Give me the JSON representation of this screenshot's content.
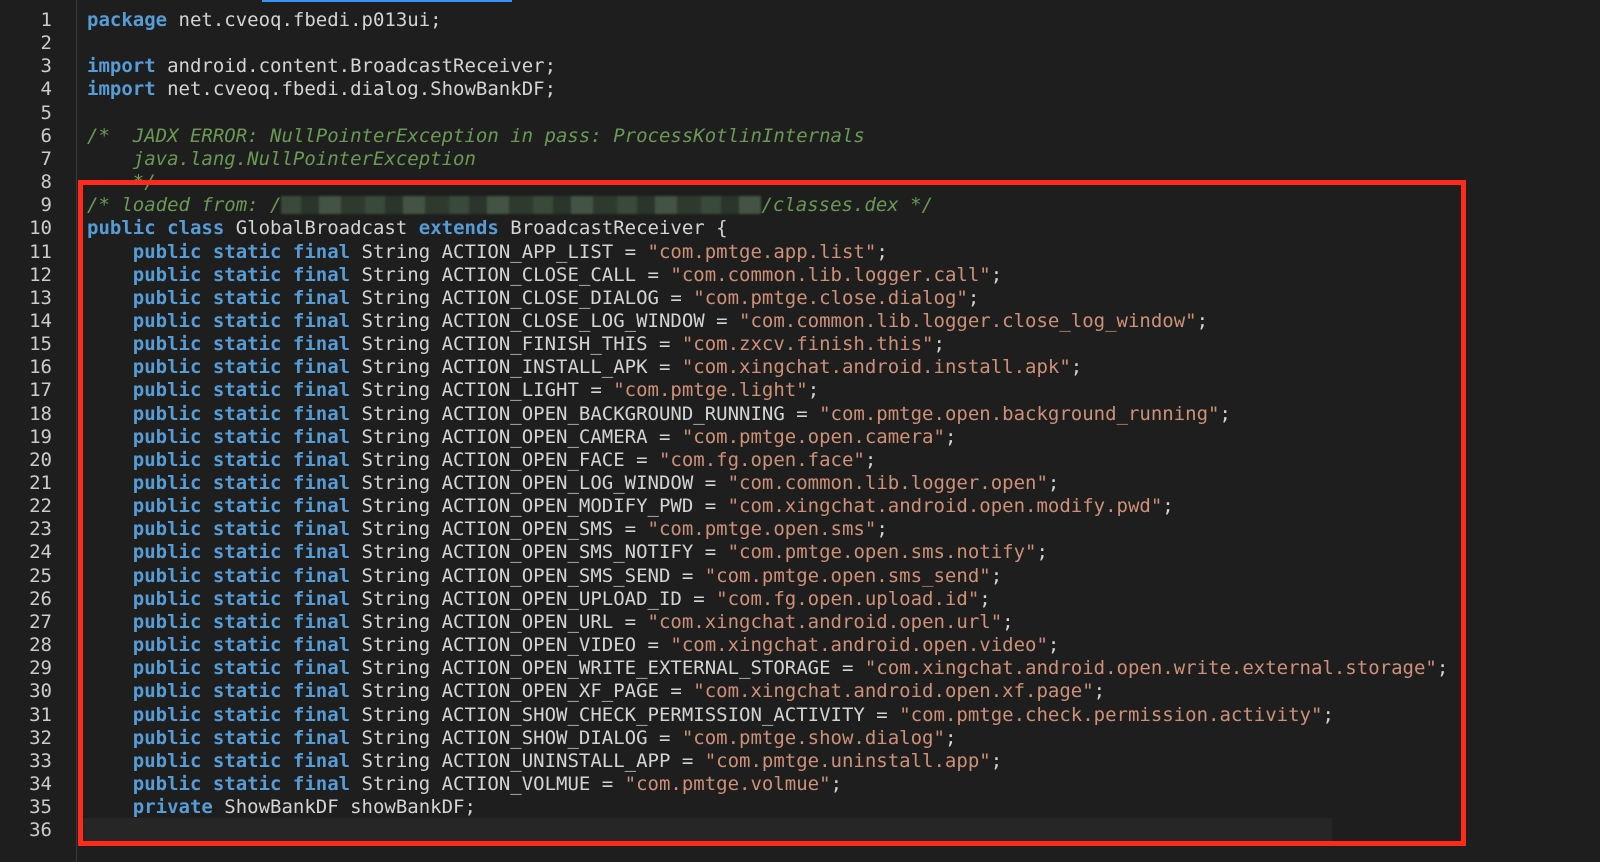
{
  "editor": {
    "lines": [
      {
        "n": "1",
        "tokens": [
          {
            "t": "kw",
            "v": "package"
          },
          {
            "t": "ty",
            "v": " net.cveoq.fbedi.p013ui;"
          }
        ]
      },
      {
        "n": "2",
        "tokens": []
      },
      {
        "n": "3",
        "tokens": [
          {
            "t": "kw",
            "v": "import"
          },
          {
            "t": "ty",
            "v": " android.content.BroadcastReceiver;"
          }
        ]
      },
      {
        "n": "4",
        "tokens": [
          {
            "t": "kw",
            "v": "import"
          },
          {
            "t": "ty",
            "v": " net.cveoq.fbedi.dialog.ShowBankDF;"
          }
        ]
      },
      {
        "n": "5",
        "tokens": []
      },
      {
        "n": "6",
        "tokens": [
          {
            "t": "cm",
            "v": "/*  JADX ERROR: NullPointerException in pass: ProcessKotlinInternals"
          }
        ]
      },
      {
        "n": "7",
        "tokens": [
          {
            "t": "cm",
            "v": "    java.lang.NullPointerException"
          }
        ]
      },
      {
        "n": "8",
        "tokens": [
          {
            "t": "cm",
            "v": "    */"
          }
        ]
      },
      {
        "n": "9",
        "tokens": [
          {
            "t": "cm",
            "v": "/* loaded from: /"
          },
          {
            "t": "redact",
            "v": ""
          },
          {
            "t": "cm",
            "v": "/classes.dex */"
          }
        ]
      },
      {
        "n": "10",
        "tokens": [
          {
            "t": "kw",
            "v": "public class"
          },
          {
            "t": "ty",
            "v": " GlobalBroadcast "
          },
          {
            "t": "kw",
            "v": "extends"
          },
          {
            "t": "ty",
            "v": " BroadcastReceiver {"
          }
        ]
      },
      {
        "n": "11",
        "tokens": [
          {
            "t": "ty",
            "v": "    "
          },
          {
            "t": "kw",
            "v": "public static final"
          },
          {
            "t": "ty",
            "v": " String ACTION_APP_LIST = "
          },
          {
            "t": "str",
            "v": "\"com.pmtge.app.list\""
          },
          {
            "t": "ty",
            "v": ";"
          }
        ]
      },
      {
        "n": "12",
        "tokens": [
          {
            "t": "ty",
            "v": "    "
          },
          {
            "t": "kw",
            "v": "public static final"
          },
          {
            "t": "ty",
            "v": " String ACTION_CLOSE_CALL = "
          },
          {
            "t": "str",
            "v": "\"com.common.lib.logger.call\""
          },
          {
            "t": "ty",
            "v": ";"
          }
        ]
      },
      {
        "n": "13",
        "tokens": [
          {
            "t": "ty",
            "v": "    "
          },
          {
            "t": "kw",
            "v": "public static final"
          },
          {
            "t": "ty",
            "v": " String ACTION_CLOSE_DIALOG = "
          },
          {
            "t": "str",
            "v": "\"com.pmtge.close.dialog\""
          },
          {
            "t": "ty",
            "v": ";"
          }
        ]
      },
      {
        "n": "14",
        "tokens": [
          {
            "t": "ty",
            "v": "    "
          },
          {
            "t": "kw",
            "v": "public static final"
          },
          {
            "t": "ty",
            "v": " String ACTION_CLOSE_LOG_WINDOW = "
          },
          {
            "t": "str",
            "v": "\"com.common.lib.logger.close_log_window\""
          },
          {
            "t": "ty",
            "v": ";"
          }
        ]
      },
      {
        "n": "15",
        "tokens": [
          {
            "t": "ty",
            "v": "    "
          },
          {
            "t": "kw",
            "v": "public static final"
          },
          {
            "t": "ty",
            "v": " String ACTION_FINISH_THIS = "
          },
          {
            "t": "str",
            "v": "\"com.zxcv.finish.this\""
          },
          {
            "t": "ty",
            "v": ";"
          }
        ]
      },
      {
        "n": "16",
        "tokens": [
          {
            "t": "ty",
            "v": "    "
          },
          {
            "t": "kw",
            "v": "public static final"
          },
          {
            "t": "ty",
            "v": " String ACTION_INSTALL_APK = "
          },
          {
            "t": "str",
            "v": "\"com.xingchat.android.install.apk\""
          },
          {
            "t": "ty",
            "v": ";"
          }
        ]
      },
      {
        "n": "17",
        "tokens": [
          {
            "t": "ty",
            "v": "    "
          },
          {
            "t": "kw",
            "v": "public static final"
          },
          {
            "t": "ty",
            "v": " String ACTION_LIGHT = "
          },
          {
            "t": "str",
            "v": "\"com.pmtge.light\""
          },
          {
            "t": "ty",
            "v": ";"
          }
        ]
      },
      {
        "n": "18",
        "tokens": [
          {
            "t": "ty",
            "v": "    "
          },
          {
            "t": "kw",
            "v": "public static final"
          },
          {
            "t": "ty",
            "v": " String ACTION_OPEN_BACKGROUND_RUNNING = "
          },
          {
            "t": "str",
            "v": "\"com.pmtge.open.background_running\""
          },
          {
            "t": "ty",
            "v": ";"
          }
        ]
      },
      {
        "n": "19",
        "tokens": [
          {
            "t": "ty",
            "v": "    "
          },
          {
            "t": "kw",
            "v": "public static final"
          },
          {
            "t": "ty",
            "v": " String ACTION_OPEN_CAMERA = "
          },
          {
            "t": "str",
            "v": "\"com.pmtge.open.camera\""
          },
          {
            "t": "ty",
            "v": ";"
          }
        ]
      },
      {
        "n": "20",
        "tokens": [
          {
            "t": "ty",
            "v": "    "
          },
          {
            "t": "kw",
            "v": "public static final"
          },
          {
            "t": "ty",
            "v": " String ACTION_OPEN_FACE = "
          },
          {
            "t": "str",
            "v": "\"com.fg.open.face\""
          },
          {
            "t": "ty",
            "v": ";"
          }
        ]
      },
      {
        "n": "21",
        "tokens": [
          {
            "t": "ty",
            "v": "    "
          },
          {
            "t": "kw",
            "v": "public static final"
          },
          {
            "t": "ty",
            "v": " String ACTION_OPEN_LOG_WINDOW = "
          },
          {
            "t": "str",
            "v": "\"com.common.lib.logger.open\""
          },
          {
            "t": "ty",
            "v": ";"
          }
        ]
      },
      {
        "n": "22",
        "tokens": [
          {
            "t": "ty",
            "v": "    "
          },
          {
            "t": "kw",
            "v": "public static final"
          },
          {
            "t": "ty",
            "v": " String ACTION_OPEN_MODIFY_PWD = "
          },
          {
            "t": "str",
            "v": "\"com.xingchat.android.open.modify.pwd\""
          },
          {
            "t": "ty",
            "v": ";"
          }
        ]
      },
      {
        "n": "23",
        "tokens": [
          {
            "t": "ty",
            "v": "    "
          },
          {
            "t": "kw",
            "v": "public static final"
          },
          {
            "t": "ty",
            "v": " String ACTION_OPEN_SMS = "
          },
          {
            "t": "str",
            "v": "\"com.pmtge.open.sms\""
          },
          {
            "t": "ty",
            "v": ";"
          }
        ]
      },
      {
        "n": "24",
        "tokens": [
          {
            "t": "ty",
            "v": "    "
          },
          {
            "t": "kw",
            "v": "public static final"
          },
          {
            "t": "ty",
            "v": " String ACTION_OPEN_SMS_NOTIFY = "
          },
          {
            "t": "str",
            "v": "\"com.pmtge.open.sms.notify\""
          },
          {
            "t": "ty",
            "v": ";"
          }
        ]
      },
      {
        "n": "25",
        "tokens": [
          {
            "t": "ty",
            "v": "    "
          },
          {
            "t": "kw",
            "v": "public static final"
          },
          {
            "t": "ty",
            "v": " String ACTION_OPEN_SMS_SEND = "
          },
          {
            "t": "str",
            "v": "\"com.pmtge.open.sms_send\""
          },
          {
            "t": "ty",
            "v": ";"
          }
        ]
      },
      {
        "n": "26",
        "tokens": [
          {
            "t": "ty",
            "v": "    "
          },
          {
            "t": "kw",
            "v": "public static final"
          },
          {
            "t": "ty",
            "v": " String ACTION_OPEN_UPLOAD_ID = "
          },
          {
            "t": "str",
            "v": "\"com.fg.open.upload.id\""
          },
          {
            "t": "ty",
            "v": ";"
          }
        ]
      },
      {
        "n": "27",
        "tokens": [
          {
            "t": "ty",
            "v": "    "
          },
          {
            "t": "kw",
            "v": "public static final"
          },
          {
            "t": "ty",
            "v": " String ACTION_OPEN_URL = "
          },
          {
            "t": "str",
            "v": "\"com.xingchat.android.open.url\""
          },
          {
            "t": "ty",
            "v": ";"
          }
        ]
      },
      {
        "n": "28",
        "tokens": [
          {
            "t": "ty",
            "v": "    "
          },
          {
            "t": "kw",
            "v": "public static final"
          },
          {
            "t": "ty",
            "v": " String ACTION_OPEN_VIDEO = "
          },
          {
            "t": "str",
            "v": "\"com.xingchat.android.open.video\""
          },
          {
            "t": "ty",
            "v": ";"
          }
        ]
      },
      {
        "n": "29",
        "tokens": [
          {
            "t": "ty",
            "v": "    "
          },
          {
            "t": "kw",
            "v": "public static final"
          },
          {
            "t": "ty",
            "v": " String ACTION_OPEN_WRITE_EXTERNAL_STORAGE = "
          },
          {
            "t": "str",
            "v": "\"com.xingchat.android.open.write.external.storage\""
          },
          {
            "t": "ty",
            "v": ";"
          }
        ]
      },
      {
        "n": "30",
        "tokens": [
          {
            "t": "ty",
            "v": "    "
          },
          {
            "t": "kw",
            "v": "public static final"
          },
          {
            "t": "ty",
            "v": " String ACTION_OPEN_XF_PAGE = "
          },
          {
            "t": "str",
            "v": "\"com.xingchat.android.open.xf.page\""
          },
          {
            "t": "ty",
            "v": ";"
          }
        ]
      },
      {
        "n": "31",
        "tokens": [
          {
            "t": "ty",
            "v": "    "
          },
          {
            "t": "kw",
            "v": "public static final"
          },
          {
            "t": "ty",
            "v": " String ACTION_SHOW_CHECK_PERMISSION_ACTIVITY = "
          },
          {
            "t": "str",
            "v": "\"com.pmtge.check.permission.activity\""
          },
          {
            "t": "ty",
            "v": ";"
          }
        ]
      },
      {
        "n": "32",
        "tokens": [
          {
            "t": "ty",
            "v": "    "
          },
          {
            "t": "kw",
            "v": "public static final"
          },
          {
            "t": "ty",
            "v": " String ACTION_SHOW_DIALOG = "
          },
          {
            "t": "str",
            "v": "\"com.pmtge.show.dialog\""
          },
          {
            "t": "ty",
            "v": ";"
          }
        ]
      },
      {
        "n": "33",
        "tokens": [
          {
            "t": "ty",
            "v": "    "
          },
          {
            "t": "kw",
            "v": "public static final"
          },
          {
            "t": "ty",
            "v": " String ACTION_UNINSTALL_APP = "
          },
          {
            "t": "str",
            "v": "\"com.pmtge.uninstall.app\""
          },
          {
            "t": "ty",
            "v": ";"
          }
        ]
      },
      {
        "n": "34",
        "tokens": [
          {
            "t": "ty",
            "v": "    "
          },
          {
            "t": "kw",
            "v": "public static final"
          },
          {
            "t": "ty",
            "v": " String ACTION_VOLMUE = "
          },
          {
            "t": "str",
            "v": "\"com.pmtge.volmue\""
          },
          {
            "t": "ty",
            "v": ";"
          }
        ]
      },
      {
        "n": "35",
        "tokens": [
          {
            "t": "ty",
            "v": "    "
          },
          {
            "t": "kw",
            "v": "private"
          },
          {
            "t": "ty",
            "v": " ShowBankDF showBankDF;"
          }
        ]
      },
      {
        "n": "36",
        "tokens": []
      }
    ]
  },
  "colors": {
    "background": "#1e1e1e",
    "keyword": "#569cd6",
    "string": "#ce9178",
    "comment": "#6a9955",
    "plain": "#d4d4d4",
    "line_number": "#cccccc",
    "highlight_box": "#ff2a1a",
    "tab_indicator": "#3794ff"
  }
}
